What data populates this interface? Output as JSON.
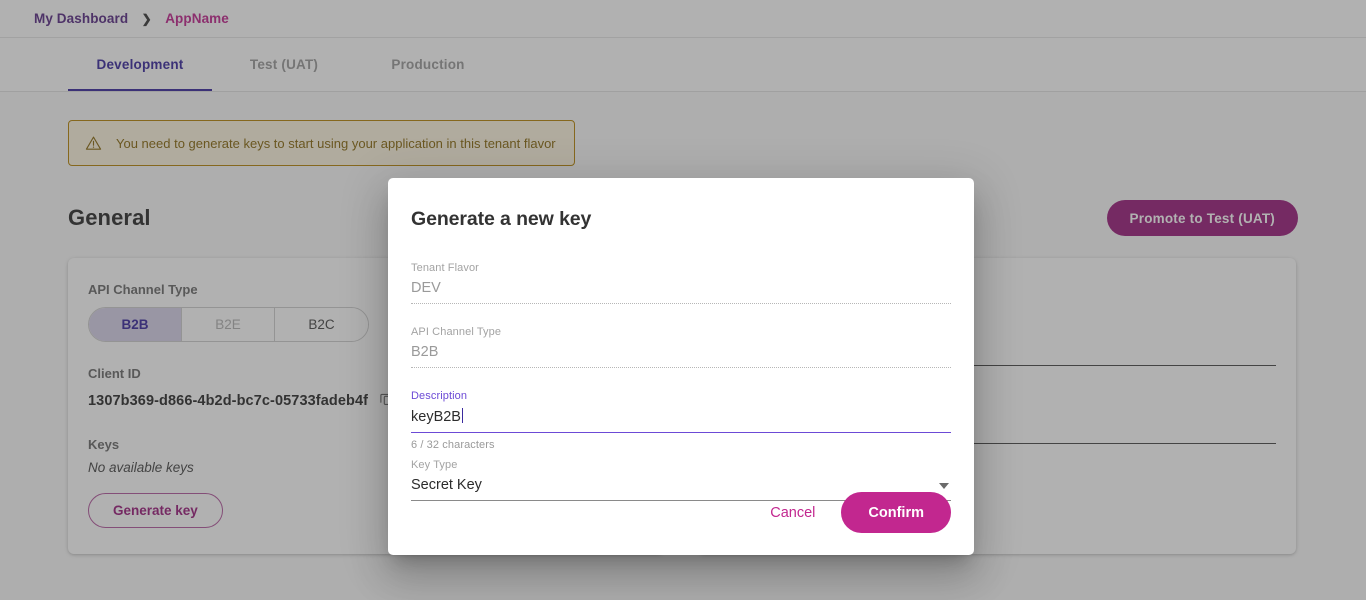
{
  "breadcrumb": {
    "root": "My Dashboard",
    "separator": "❯",
    "current": "AppName"
  },
  "tabs": [
    {
      "label": "Development",
      "active": true
    },
    {
      "label": "Test (UAT)",
      "active": false
    },
    {
      "label": "Production",
      "active": false
    }
  ],
  "warning": {
    "icon": "warning-triangle-icon",
    "text": "You need to generate keys to start using your application in this tenant flavor"
  },
  "section": {
    "title": "General",
    "promote_button": "Promote to Test (UAT)"
  },
  "left_card": {
    "api_channel_type_label": "API Channel Type",
    "segments": [
      {
        "label": "B2B",
        "selected": true,
        "muted": false
      },
      {
        "label": "B2E",
        "selected": false,
        "muted": true
      },
      {
        "label": "B2C",
        "selected": false,
        "muted": false
      }
    ],
    "client_id_label": "Client ID",
    "client_id_value": "1307b369-d866-4b2d-bc7c-05733fadeb4f",
    "copy_icon": "copy-icon",
    "keys_label": "Keys",
    "no_keys_text": "No available keys",
    "generate_key_button": "Generate key"
  },
  "modal": {
    "title": "Generate a new key",
    "fields": {
      "tenant_flavor": {
        "label": "Tenant Flavor",
        "value": "DEV"
      },
      "api_channel_type": {
        "label": "API Channel Type",
        "value": "B2B"
      },
      "description": {
        "label": "Description",
        "value": "keyB2B",
        "hint": "6 / 32 characters",
        "max_length": 32,
        "current_length": 6
      },
      "key_type": {
        "label": "Key Type",
        "value": "Secret Key",
        "dropdown_icon": "chevron-down-icon"
      }
    },
    "cancel_button": "Cancel",
    "confirm_button": "Confirm"
  },
  "colors": {
    "brand_magenta": "#c2278f",
    "brand_purple": "#3b2b9e",
    "accent_focus": "#6c4ad6",
    "promote_button": "#9c1f7d",
    "warning_border": "#b8860b",
    "warning_text": "#8a6a10"
  }
}
